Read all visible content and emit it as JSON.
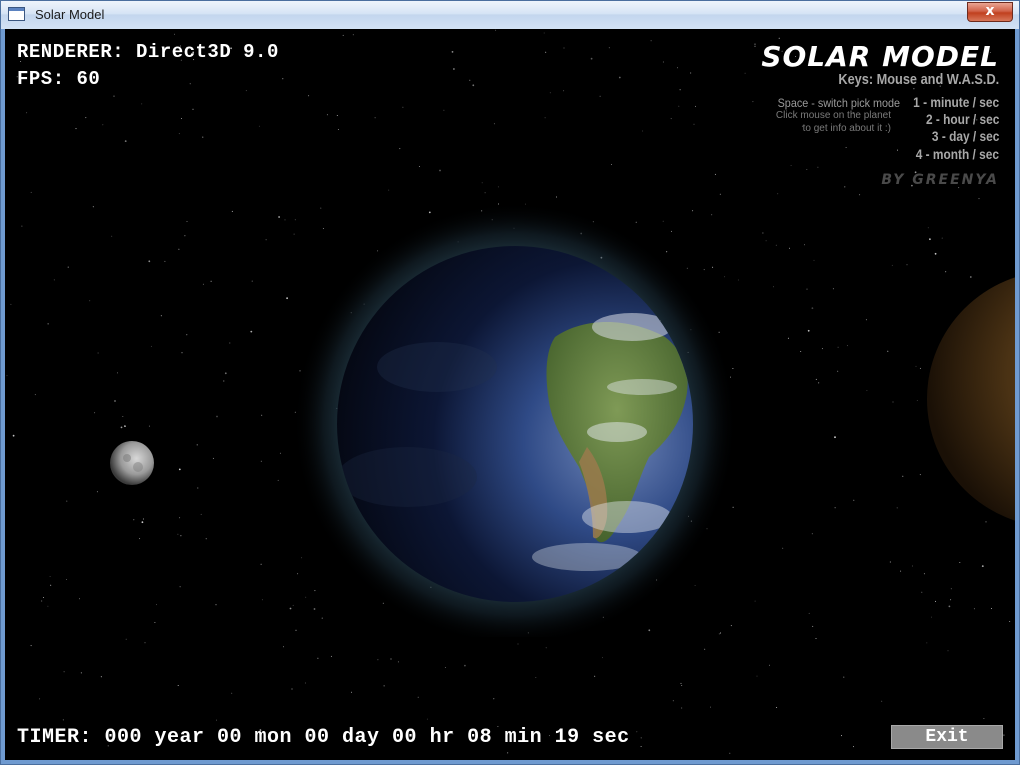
{
  "window": {
    "title": "Solar Model",
    "close_label": "x"
  },
  "hud": {
    "renderer": "RENDERER: Direct3D 9.0",
    "fps": "FPS: 60",
    "timer": "TIMER: 000 year 00 mon 00 day 00 hr 08 min 19 sec"
  },
  "info": {
    "logo": "SOLAR MODEL",
    "keys": "Keys:  Mouse and W.A.S.D.",
    "pick_mode": "Space - switch pick mode",
    "hint_line1": "Click mouse on the planet",
    "hint_line2": "to get info about it :)",
    "hotkeys": [
      "1 - minute / sec",
      "2 - hour / sec",
      "3 - day / sec",
      "4 - month / sec"
    ],
    "credit": "BY GREENYA"
  },
  "controls": {
    "exit_label": "Exit"
  },
  "colors": {
    "space": "#000000",
    "hud_text": "#ffffff",
    "info_text": "#a8a8a8",
    "exit_button": "#8a8a8a",
    "titlebar": "#d6e4f5"
  }
}
